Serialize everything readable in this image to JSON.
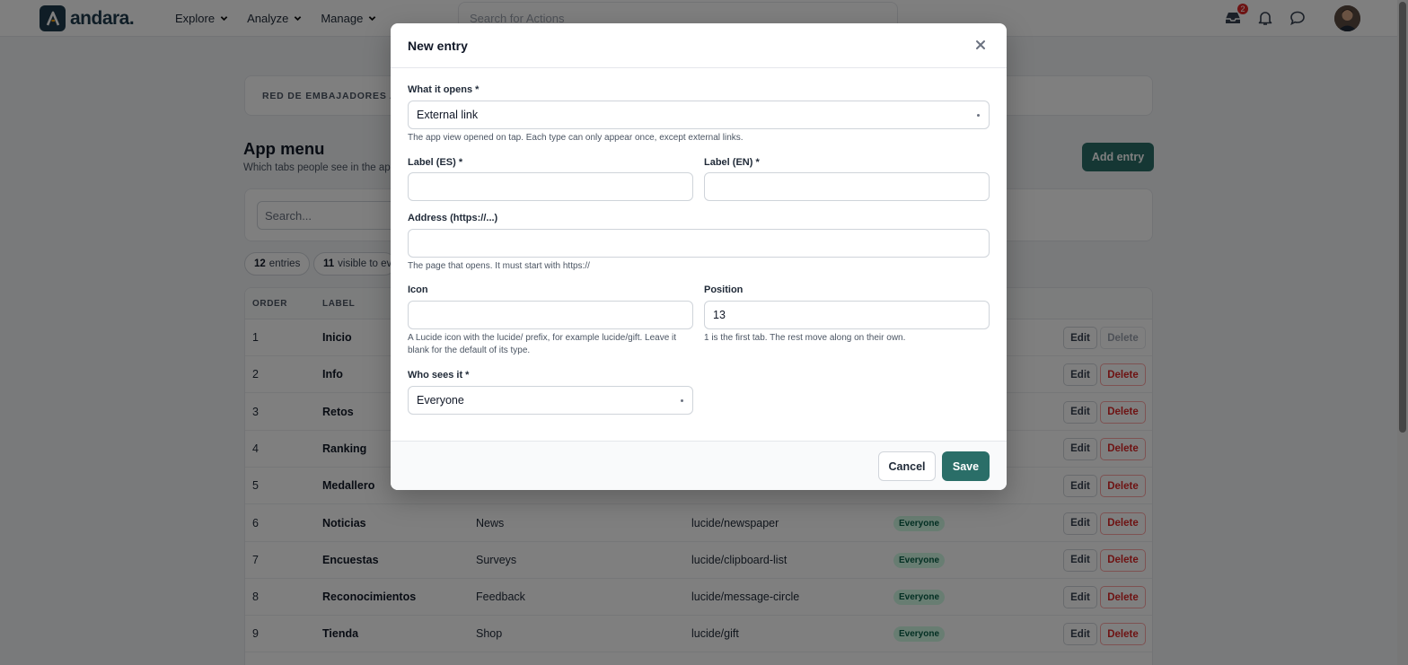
{
  "brand": {
    "name": "andara."
  },
  "nav": {
    "items": [
      {
        "label": "Explore"
      },
      {
        "label": "Analyze"
      },
      {
        "label": "Manage"
      }
    ],
    "search_placeholder": "Search for Actions",
    "inbox_count": "2"
  },
  "page": {
    "brand_strip": "RED DE EMBAJADORES AND",
    "title": "App menu",
    "subtitle": "Which tabs people see in the app",
    "add_entry_label": "Add entry",
    "search_placeholder": "Search...",
    "entries_count": "12",
    "entries_label": "entries",
    "visible_count": "11",
    "visible_label": "visible to eve"
  },
  "table": {
    "columns": {
      "order": "ORDER",
      "label": "LABEL"
    },
    "rows": [
      {
        "order": "1",
        "label": "Inicio",
        "label_en": "",
        "icon": "",
        "audience": "",
        "delete_disabled": true
      },
      {
        "order": "2",
        "label": "Info",
        "label_en": "",
        "icon": "",
        "audience": ""
      },
      {
        "order": "3",
        "label": "Retos",
        "label_en": "",
        "icon": "",
        "audience": ""
      },
      {
        "order": "4",
        "label": "Ranking",
        "label_en": "",
        "icon": "",
        "audience": ""
      },
      {
        "order": "5",
        "label": "Medallero",
        "label_en": "",
        "icon": "",
        "audience": ""
      },
      {
        "order": "6",
        "label": "Noticias",
        "label_en": "News",
        "icon": "lucide/newspaper",
        "audience": "Everyone"
      },
      {
        "order": "7",
        "label": "Encuestas",
        "label_en": "Surveys",
        "icon": "lucide/clipboard-list",
        "audience": "Everyone"
      },
      {
        "order": "8",
        "label": "Reconocimientos",
        "label_en": "Feedback",
        "icon": "lucide/message-circle",
        "audience": "Everyone"
      },
      {
        "order": "9",
        "label": "Tienda",
        "label_en": "Shop",
        "icon": "lucide/gift",
        "audience": "Everyone"
      }
    ],
    "edit_label": "Edit",
    "delete_label": "Delete"
  },
  "modal": {
    "title": "New entry",
    "what_opens_label": "What it opens *",
    "what_opens_value": "External link",
    "what_opens_help": "The app view opened on tap. Each type can only appear once, except external links.",
    "label_es_label": "Label (ES) *",
    "label_es_value": "",
    "label_en_label": "Label (EN) *",
    "label_en_value": "",
    "address_label": "Address (https://...)",
    "address_value": "",
    "address_help": "The page that opens. It must start with https://",
    "icon_label": "Icon",
    "icon_value": "",
    "icon_help": "A Lucide icon with the lucide/ prefix, for example lucide/gift. Leave it blank for the default of its type.",
    "position_label": "Position",
    "position_value": "13",
    "position_help": "1 is the first tab. The rest move along on their own.",
    "who_label": "Who sees it *",
    "who_value": "Everyone",
    "cancel_label": "Cancel",
    "save_label": "Save"
  },
  "colors": {
    "accent": "#2a6e68",
    "danger": "#dc2626",
    "brand_dark": "#1e3a4c"
  }
}
